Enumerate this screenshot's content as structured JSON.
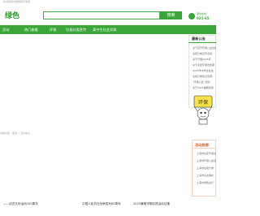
{
  "top_text": "欢迎来到中国绿色环保网",
  "logo_text": "绿色",
  "search": {
    "placeholder": "",
    "button": "搜索"
  },
  "hotline": {
    "label": "服务热线",
    "number": "021-65"
  },
  "nav": {
    "items": [
      "活动",
      "热门查看",
      "环保",
      "垃圾分类宣传",
      "高中生社会实践"
    ]
  },
  "notices": {
    "title": "最新公告",
    "items": [
      "关于召开环保公益活动",
      "垃圾分类宣传活动",
      "关于开展2025年",
      "关于表彰环保志愿者",
      "2025年中学生社会",
      "垃圾分类知识竞赛",
      "“环保公益”活动",
      "关于2025暑期实践"
    ]
  },
  "mascot": {
    "text": "环保"
  },
  "breadcrumb": "当前位置：首页 > 活动中心",
  "activities": {
    "title": "活动热榜",
    "items": [
      "上海市社区环保活动",
      "上海市环保公益活动",
      "上海市垃圾分类",
      "上海市生态保护",
      "上海市绿色出行"
    ]
  },
  "ticker": [
    "——纪念五卅运动100周年",
    "中国人民抗日战争胜利80周年",
    "2025暑假学期实践活动征集"
  ],
  "colors": {
    "brand_green": "#3aa63a",
    "accent_orange": "#e45b1e"
  }
}
